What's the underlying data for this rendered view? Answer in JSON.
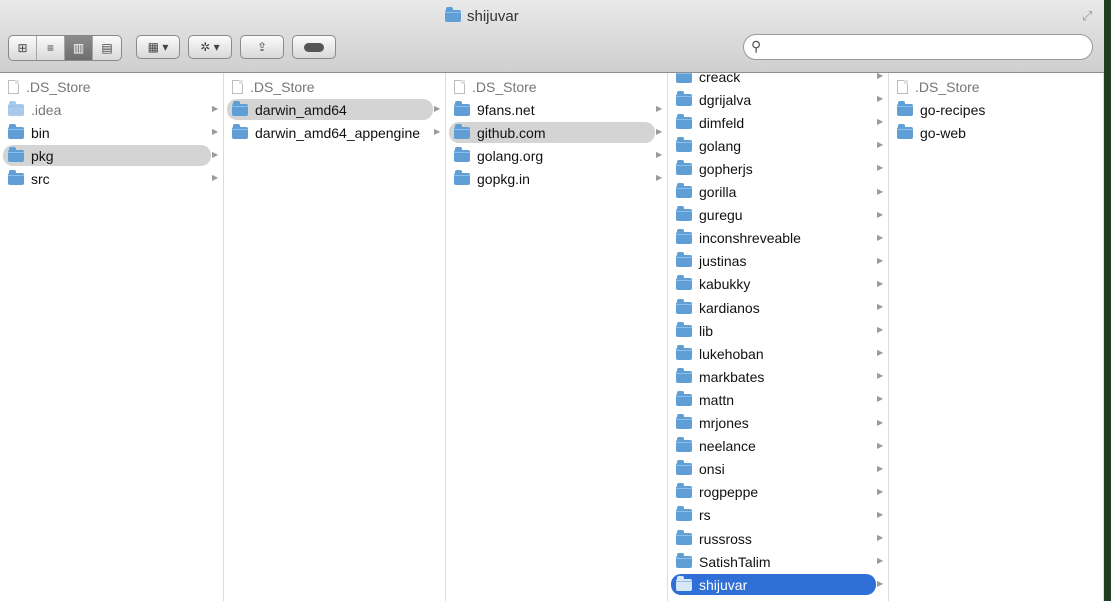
{
  "window": {
    "title": "shijuvar"
  },
  "toolbar": {
    "view_buttons": [
      {
        "name": "icon-view",
        "glyph": "⊞"
      },
      {
        "name": "list-view",
        "glyph": "≡"
      },
      {
        "name": "column-view",
        "glyph": "▥",
        "active": true
      },
      {
        "name": "coverflow-view",
        "glyph": "▤"
      }
    ],
    "arrange_glyph": "▦ ▾",
    "action_glyph": "✲ ▾",
    "share_glyph": "⇪",
    "search": {
      "placeholder": "",
      "value": ""
    }
  },
  "columns": [
    {
      "items": [
        {
          "name": ".DS_Store",
          "kind": "file"
        },
        {
          "name": ".idea",
          "kind": "folder",
          "faded": true,
          "arrow": true
        },
        {
          "name": "bin",
          "kind": "folder",
          "arrow": true
        },
        {
          "name": "pkg",
          "kind": "folder",
          "arrow": true,
          "selected": true
        },
        {
          "name": "src",
          "kind": "folder",
          "arrow": true
        }
      ]
    },
    {
      "items": [
        {
          "name": ".DS_Store",
          "kind": "file"
        },
        {
          "name": "darwin_amd64",
          "kind": "folder",
          "arrow": true,
          "selected": true
        },
        {
          "name": "darwin_amd64_appengine",
          "kind": "folder",
          "arrow": true
        }
      ]
    },
    {
      "items": [
        {
          "name": ".DS_Store",
          "kind": "file"
        },
        {
          "name": "9fans.net",
          "kind": "folder",
          "arrow": true
        },
        {
          "name": "github.com",
          "kind": "folder",
          "arrow": true,
          "selected": true
        },
        {
          "name": "golang.org",
          "kind": "folder",
          "arrow": true
        },
        {
          "name": "gopkg.in",
          "kind": "folder",
          "arrow": true
        }
      ]
    },
    {
      "items": [
        {
          "name": "creack",
          "kind": "folder",
          "arrow": true
        },
        {
          "name": "dgrijalva",
          "kind": "folder",
          "arrow": true
        },
        {
          "name": "dimfeld",
          "kind": "folder",
          "arrow": true
        },
        {
          "name": "golang",
          "kind": "folder",
          "arrow": true
        },
        {
          "name": "gopherjs",
          "kind": "folder",
          "arrow": true
        },
        {
          "name": "gorilla",
          "kind": "folder",
          "arrow": true
        },
        {
          "name": "guregu",
          "kind": "folder",
          "arrow": true
        },
        {
          "name": "inconshreveable",
          "kind": "folder",
          "arrow": true
        },
        {
          "name": "justinas",
          "kind": "folder",
          "arrow": true
        },
        {
          "name": "kabukky",
          "kind": "folder",
          "arrow": true
        },
        {
          "name": "kardianos",
          "kind": "folder",
          "arrow": true
        },
        {
          "name": "lib",
          "kind": "folder",
          "arrow": true
        },
        {
          "name": "lukehoban",
          "kind": "folder",
          "arrow": true
        },
        {
          "name": "markbates",
          "kind": "folder",
          "arrow": true
        },
        {
          "name": "mattn",
          "kind": "folder",
          "arrow": true
        },
        {
          "name": "mrjones",
          "kind": "folder",
          "arrow": true
        },
        {
          "name": "neelance",
          "kind": "folder",
          "arrow": true
        },
        {
          "name": "onsi",
          "kind": "folder",
          "arrow": true
        },
        {
          "name": "rogpeppe",
          "kind": "folder",
          "arrow": true
        },
        {
          "name": "rs",
          "kind": "folder",
          "arrow": true
        },
        {
          "name": "russross",
          "kind": "folder",
          "arrow": true
        },
        {
          "name": "SatishTalim",
          "kind": "folder",
          "arrow": true
        },
        {
          "name": "shijuvar",
          "kind": "folder",
          "arrow": true,
          "active": true
        }
      ]
    },
    {
      "items": [
        {
          "name": ".DS_Store",
          "kind": "file"
        },
        {
          "name": "go-recipes",
          "kind": "folder"
        },
        {
          "name": "go-web",
          "kind": "folder"
        }
      ]
    }
  ]
}
